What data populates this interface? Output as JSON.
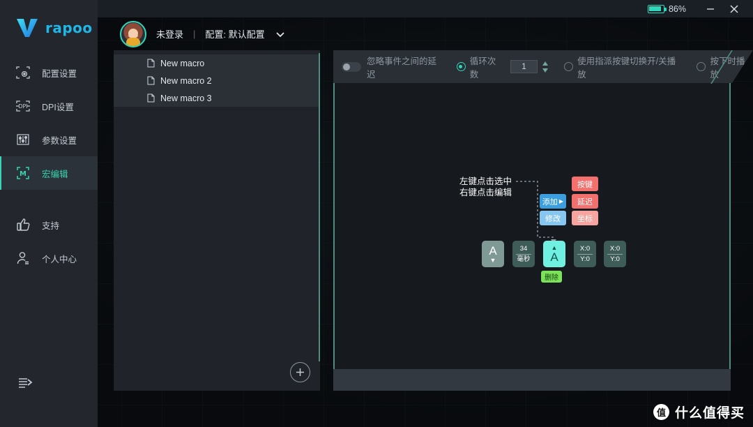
{
  "titlebar": {
    "battery_icon": "battery-icon",
    "battery_percent": "86%",
    "minimize_label": "minimize-icon",
    "close_label": "close-icon"
  },
  "sidebar": {
    "logo_text": "rapoo",
    "logo_icon": "rapoo-v-logo",
    "collapse_icon": "collapse-menu-icon",
    "items": [
      {
        "label": "配置设置",
        "icon": "profile-settings-icon",
        "active": false
      },
      {
        "label": "DPI设置",
        "icon": "dpi-settings-icon",
        "active": false
      },
      {
        "label": "参数设置",
        "icon": "parameter-settings-icon",
        "active": false
      },
      {
        "label": "宏编辑",
        "icon": "macro-editor-icon",
        "active": true
      },
      {
        "label": "支持",
        "icon": "thumbs-up-icon",
        "active": false
      },
      {
        "label": "个人中心",
        "icon": "user-center-icon",
        "active": false
      }
    ]
  },
  "account": {
    "avatar_icon": "user-avatar",
    "login_status": "未登录",
    "separator": "|",
    "profile_label": "配置: 默认配置",
    "dropdown_icon": "chevron-down-icon"
  },
  "macro_list": {
    "items": [
      {
        "label": "New macro",
        "icon": "document-icon"
      },
      {
        "label": "New macro 2",
        "icon": "document-icon"
      },
      {
        "label": "New macro 3",
        "icon": "document-icon"
      }
    ],
    "add_button_icon": "plus-circle-icon"
  },
  "toolbar": {
    "ignore_delay_label": "忽略事件之间的延迟",
    "ignore_delay_on": false,
    "loop_count_label": "循环次数",
    "loop_count_selected": true,
    "loop_count_value": "1",
    "toggle_play_label": "使用指派按键切换开/关播放",
    "toggle_play_selected": false,
    "press_play_label": "按下时播放",
    "press_play_selected": false,
    "spinner_icon": "spinner-updown-icon"
  },
  "diagram": {
    "hint_line1": "左键点击选中",
    "hint_line2": "右键点击编辑",
    "menu": {
      "add": "添加",
      "add_arrow": "▶",
      "edit": "修改",
      "key": "按键",
      "delay": "延迟",
      "coord": "坐标"
    },
    "blocks": [
      {
        "name": "key-down-block",
        "main": "A",
        "arrow": "▼",
        "sub": ""
      },
      {
        "name": "delay-block",
        "top": "34",
        "bottom": "毫秒"
      },
      {
        "name": "key-up-block",
        "main": "A",
        "arrow": "▲",
        "selected": true
      },
      {
        "name": "coord-block-1",
        "top": "X:0",
        "bottom": "Y:0"
      },
      {
        "name": "coord-block-2",
        "top": "X:0",
        "bottom": "Y:0"
      }
    ],
    "delete_label": "删除"
  },
  "watermark": {
    "badge": "值",
    "text": "什么值得买"
  },
  "colors": {
    "accent_teal": "#2fd8bb",
    "brand_blue": "#21b6e8",
    "sidebar_bg": "#23272d",
    "panel_bg": "#20242a",
    "right_panel_bg": "#16191d",
    "menu_add": "#3c9ede",
    "menu_edit": "#86c6ef",
    "menu_key": "#f2706e",
    "menu_coord": "#f7a39f",
    "block_selected": "#6ff0e0",
    "delete_green": "#7ce25b"
  }
}
